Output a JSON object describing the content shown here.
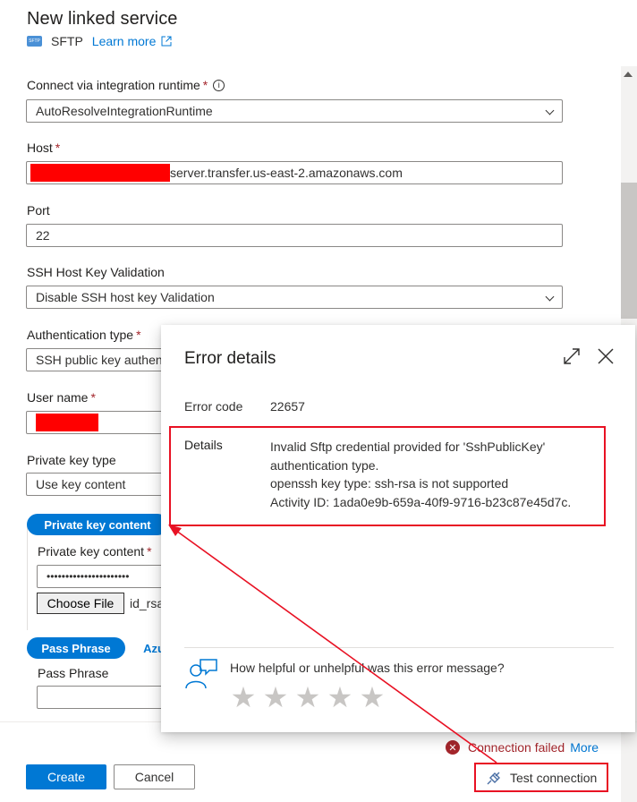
{
  "panel": {
    "title": "New linked service",
    "connector": "SFTP",
    "learn_more": "Learn more"
  },
  "form": {
    "runtime_label": "Connect via integration runtime",
    "runtime_value": "AutoResolveIntegrationRuntime",
    "host_label": "Host",
    "host_value": "server.transfer.us-east-2.amazonaws.com",
    "port_label": "Port",
    "port_value": "22",
    "ssh_label": "SSH Host Key Validation",
    "ssh_value": "Disable SSH host key Validation",
    "auth_label": "Authentication type",
    "auth_value": "SSH public key authen",
    "user_label": "User name",
    "pk_type_label": "Private key type",
    "pk_type_value": "Use key content",
    "pk_tab": "Private key content",
    "pk_content_label": "Private key content",
    "pk_content_value": "••••••••••••••••••••••",
    "choose_file": "Choose File",
    "file_name": "id_rsa",
    "pp_tab": "Pass Phrase",
    "pp_tab2": "Azu",
    "pp_label": "Pass Phrase",
    "required_mark": "*"
  },
  "footer": {
    "create": "Create",
    "cancel": "Cancel",
    "status": "Connection failed",
    "more": "More",
    "test": "Test connection"
  },
  "error_popup": {
    "title": "Error details",
    "code_label": "Error code",
    "code_value": "22657",
    "details_label": "Details",
    "details_line1": "Invalid Sftp credential provided for 'SshPublicKey'",
    "details_line2": "authentication type.",
    "details_line3": "openssh key type: ssh-rsa is not supported",
    "details_line4": "Activity ID: 1ada0e9b-659a-40f9-9716-b23c87e45d7c.",
    "feedback_q": "How helpful or unhelpful was this error message?",
    "rating": 0,
    "rating_max": 5
  },
  "colors": {
    "accent": "#0078d4",
    "error": "#a4262c",
    "annotation_red": "#e81123"
  }
}
